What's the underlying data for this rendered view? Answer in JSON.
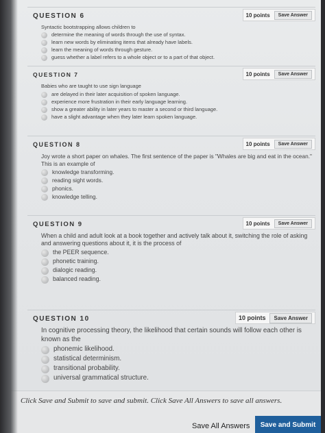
{
  "questions": [
    {
      "title": "QUESTION 6",
      "points": "10 points",
      "save_label": "Save Answer",
      "text": "Syntactic bootstrapping allows children to",
      "options": [
        "determine the meaning of words through the use of syntax.",
        "learn new words by eliminating items that already have labels.",
        "learn the meaning of words through gesture.",
        "guess whether a label refers to a whole object or to a part of that object."
      ]
    },
    {
      "title": "QUESTION 7",
      "points": "10 points",
      "save_label": "Save Answer",
      "text": "Babies who are taught to use sign language",
      "options": [
        "are delayed in their later acquisition of spoken language.",
        "experience more frustration in their early language learning.",
        "show a greater ability in later years to master a second or third language.",
        "have a slight advantage when they later learn spoken language."
      ]
    },
    {
      "title": "QUESTION 8",
      "points": "10 points",
      "save_label": "Save Answer",
      "text": "Joy wrote a short paper on whales. The first sentence of the paper is \"Whales are big and eat in the ocean.\" This is an example of",
      "options": [
        "knowledge transforming.",
        "reading sight words.",
        "phonics.",
        "knowledge telling."
      ]
    },
    {
      "title": "QUESTION 9",
      "points": "10 points",
      "save_label": "Save Answer",
      "text": "When a child and adult look at a book together and actively talk about it, switching the role of asking and answering questions about it, it is the process of",
      "options": [
        "the PEER sequence.",
        "phonetic training.",
        "dialogic reading.",
        "balanced reading."
      ]
    },
    {
      "title": "QUESTION 10",
      "points": "10 points",
      "save_label": "Save Answer",
      "text": "In cognitive processing theory, the likelihood that certain sounds will follow each other is known as the",
      "options": [
        "phonemic likelihood.",
        "statistical determinism.",
        "transitional probability.",
        "universal grammatical structure."
      ]
    }
  ],
  "footer": {
    "note": "Click Save and Submit to save and submit. Click Save All Answers to save all answers.",
    "save_all_label": "Save All Answers",
    "submit_label": "Save and Submit"
  },
  "colors": {
    "submit_button": "#1f5f9c",
    "page_background": "#e6e8ea"
  }
}
